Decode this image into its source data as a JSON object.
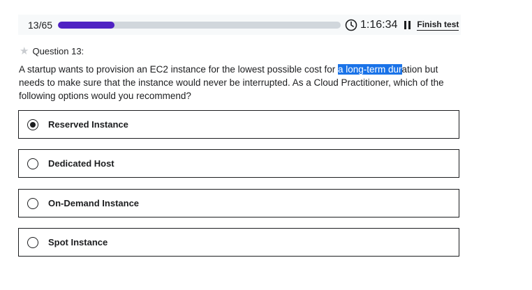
{
  "topbar": {
    "counter": "13/65",
    "progress": 0.2,
    "timer": "1:16:34",
    "finish_label": "Finish test"
  },
  "question": {
    "heading": "Question 13:",
    "text_before": "A startup wants to provision an EC2 instance for the lowest possible cost for ",
    "text_highlight": "a long-term dur",
    "text_after": "ation but needs to make sure that the instance would never be interrupted. As a Cloud Practitioner, which of the following options would you recommend?"
  },
  "options": [
    {
      "label": "Reserved Instance",
      "selected": true
    },
    {
      "label": "Dedicated Host",
      "selected": false
    },
    {
      "label": "On-Demand Instance",
      "selected": false
    },
    {
      "label": "Spot Instance",
      "selected": false
    }
  ],
  "colors": {
    "progress_fill": "#5022c3",
    "progress_track": "#d1d7dc",
    "highlight": "#1a73e8"
  }
}
